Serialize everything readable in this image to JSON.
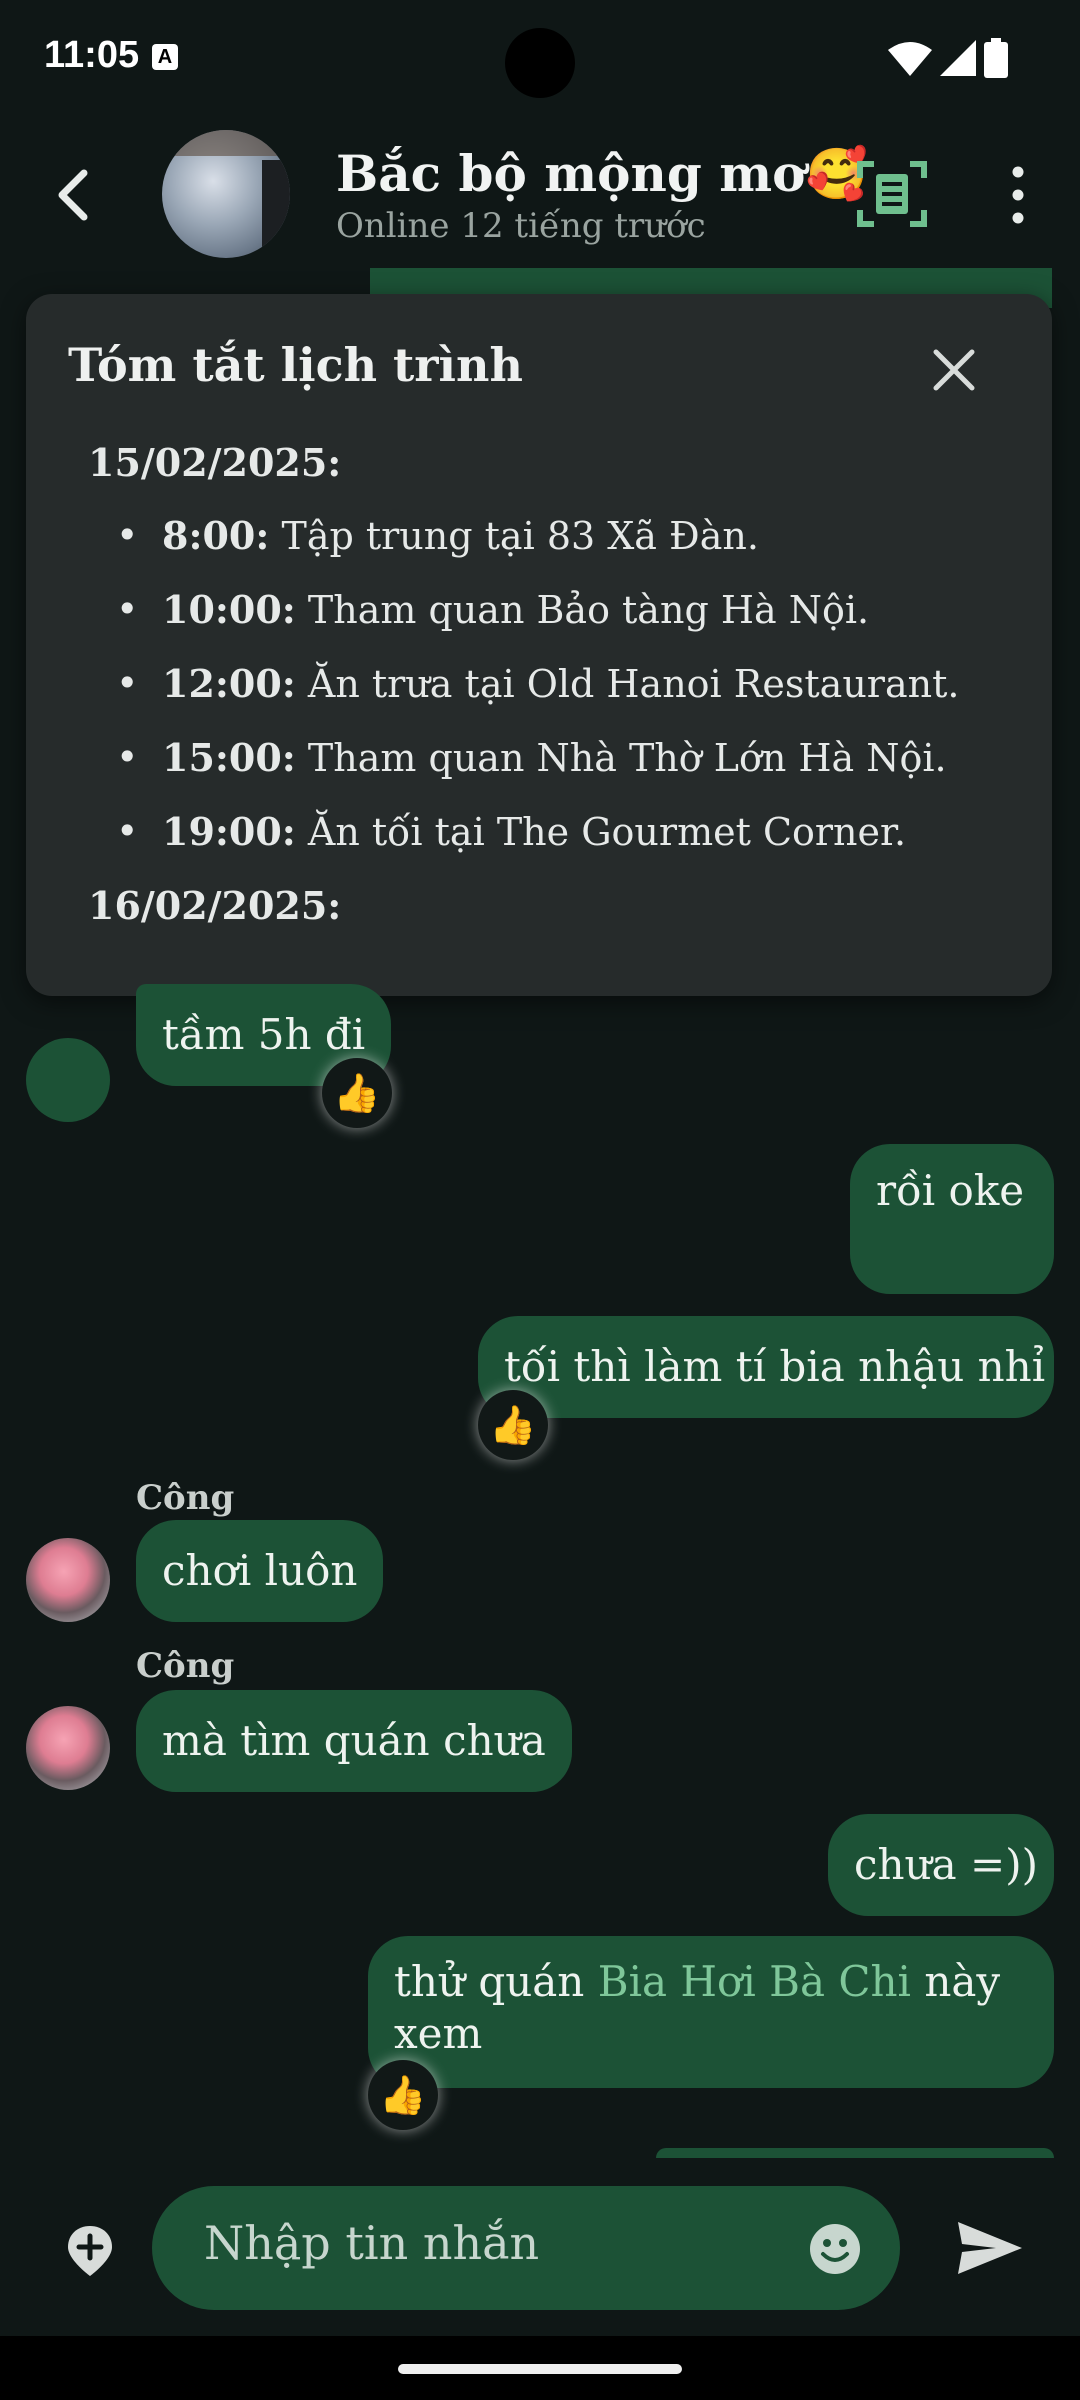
{
  "status_bar": {
    "time": "11:05",
    "notif_badge": "A"
  },
  "header": {
    "title": "Bắc bộ mộng mơ🥰",
    "subtitle": "Online 12 tiếng trước"
  },
  "summary": {
    "title": "Tóm tắt lịch trình",
    "day1": "15/02/2025:",
    "items": [
      {
        "time": "8:00:",
        "text": " Tập trung tại 83 Xã Đàn."
      },
      {
        "time": "10:00:",
        "text": " Tham quan Bảo tàng Hà Nội."
      },
      {
        "time": "12:00:",
        "text": " Ăn trưa tại Old Hanoi Restaurant."
      },
      {
        "time": "15:00:",
        "text": " Tham quan Nhà Thờ Lớn Hà Nội."
      },
      {
        "time": "19:00:",
        "text": " Ăn tối tại The Gourmet Corner."
      }
    ],
    "day2": "16/02/2025:",
    "bullet": "•"
  },
  "messages": {
    "m1": "tầm 5h đi",
    "m2": "rồi oke",
    "m3": "tối thì làm tí bia nhậu nhỉ",
    "sender1": "Công",
    "m4": "chơi luôn",
    "sender2": "Công",
    "m5": "mà tìm quán chưa",
    "m6": "chưa =))",
    "m7_pre": "thử quán ",
    "m7_link": "Bia Hơi Bà Chi",
    "m7_post": " này",
    "m7_line2": "xem",
    "reaction": "👍"
  },
  "composer": {
    "placeholder": "Nhập tin nhắn"
  },
  "colors": {
    "bubble": "#1c5236",
    "link": "#7fc79a",
    "accent": "#6fbf8e"
  }
}
